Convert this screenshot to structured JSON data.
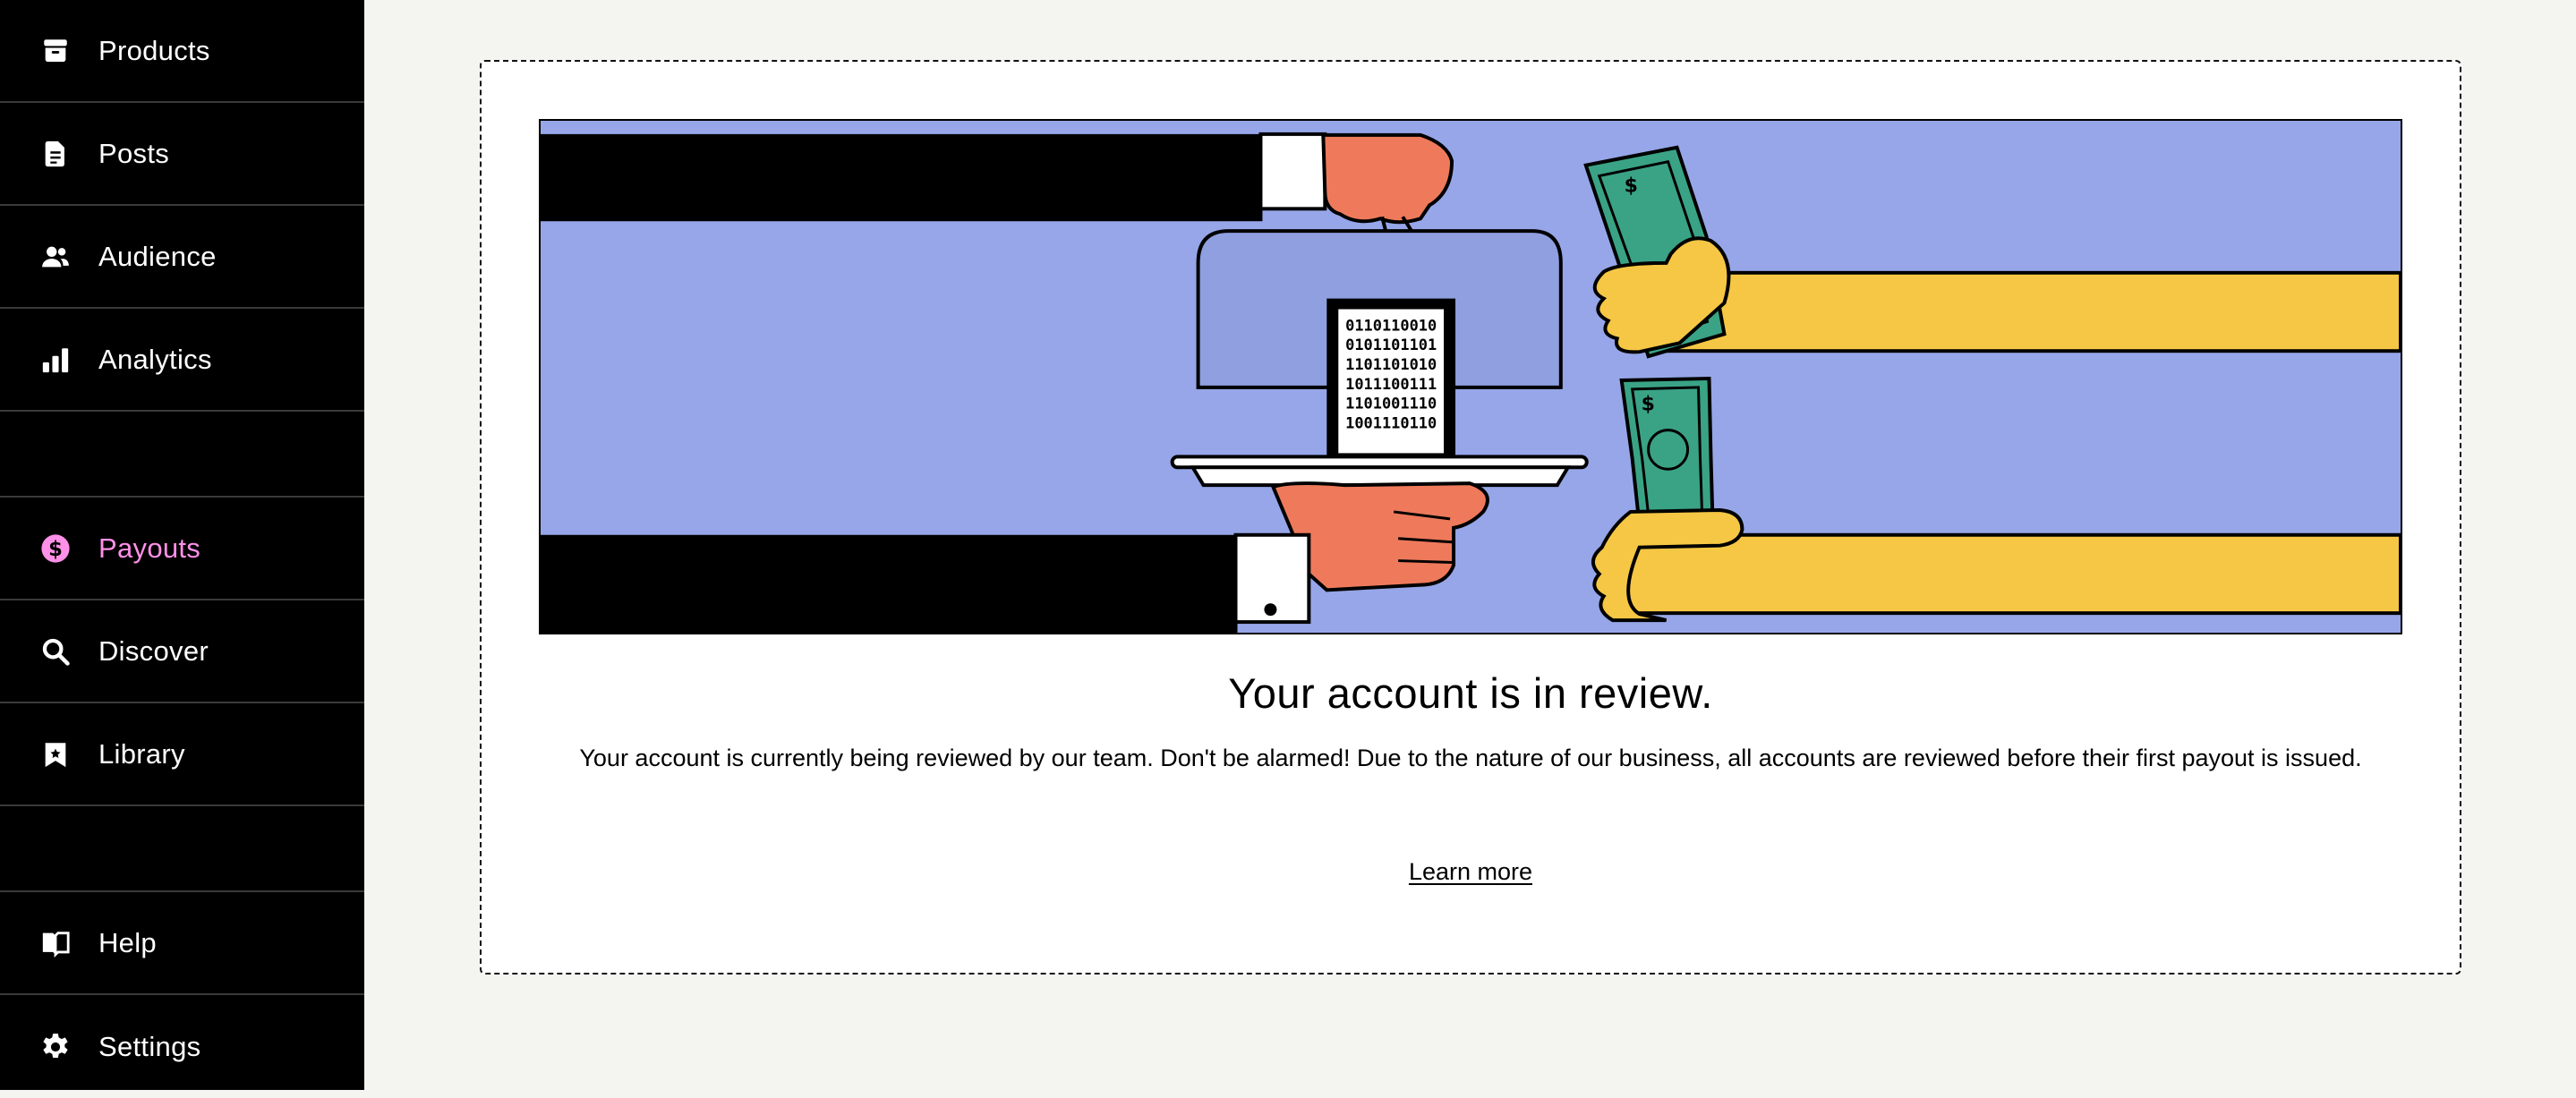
{
  "sidebar": {
    "items": [
      {
        "label": "Products",
        "icon": "archive-icon"
      },
      {
        "label": "Posts",
        "icon": "document-icon"
      },
      {
        "label": "Audience",
        "icon": "people-icon"
      },
      {
        "label": "Analytics",
        "icon": "bar-chart-icon"
      },
      {
        "label": "Payouts",
        "icon": "dollar-circle-icon",
        "active": true
      },
      {
        "label": "Discover",
        "icon": "search-icon"
      },
      {
        "label": "Library",
        "icon": "bookmark-icon"
      },
      {
        "label": "Help",
        "icon": "book-open-icon"
      },
      {
        "label": "Settings",
        "icon": "gear-icon"
      }
    ],
    "active_color": "#ff90e8"
  },
  "main": {
    "title": "Your account is in review.",
    "description": "Your account is currently being reviewed by our team. Don't be alarmed! Due to the nature of our business, all accounts are reviewed before their first payout is issued.",
    "learn_more": "Learn more"
  },
  "illustration": {
    "background": "#96a6e8",
    "code_lines": [
      "0110110010",
      "0101101101",
      "1101101010",
      "1011100111",
      "1101001110",
      "1001110110"
    ]
  }
}
